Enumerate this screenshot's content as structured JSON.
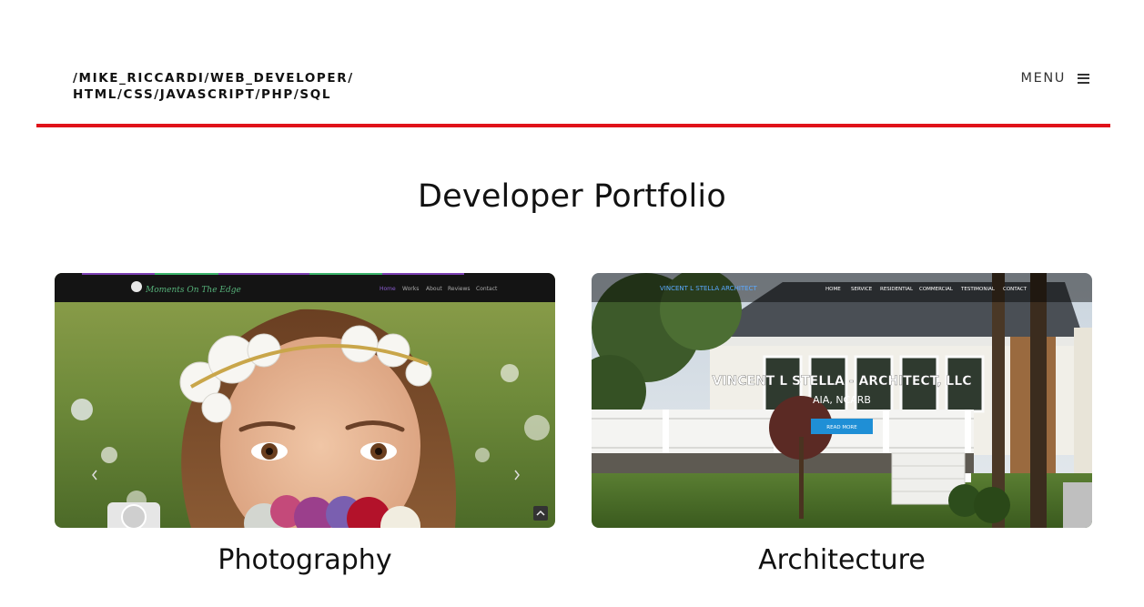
{
  "header": {
    "brand_line1": "/MIKE_RICCARDI/WEB_DEVELOPER/",
    "brand_line2": "HTML/CSS/JAVASCRIPT/PHP/SQL",
    "menu_label": "MENU",
    "accent_color": "#e0121a"
  },
  "main": {
    "title": "Developer Portfolio",
    "projects": [
      {
        "title": "Photography",
        "screenshot": {
          "nav": [
            "Home",
            "Works",
            "About",
            "Reviews",
            "Contact"
          ]
        }
      },
      {
        "title": "Architecture",
        "screenshot": {
          "nav": [
            "HOME",
            "SERVICE",
            "RESIDENTIAL",
            "COMMERCIAL",
            "TESTIMONIAL",
            "CONTACT"
          ],
          "heading": "VINCENT L STELLA - ARCHITECT, LLC",
          "subheading": "AIA, NCARB",
          "button": "READ MORE"
        }
      }
    ]
  },
  "icons": [
    "hamburger-icon",
    "camera-icon",
    "chevron-left-icon",
    "chevron-right-icon",
    "chevron-up-icon"
  ]
}
